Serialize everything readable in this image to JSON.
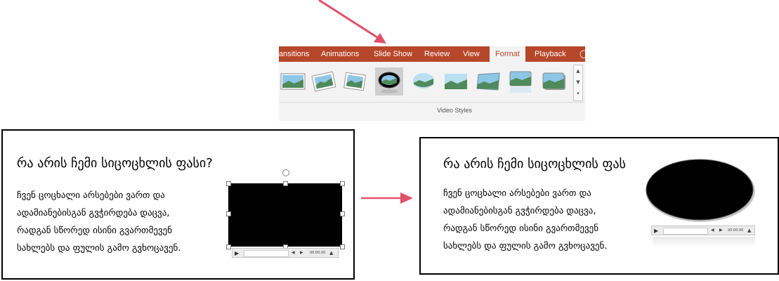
{
  "ribbon": {
    "tabs": [
      {
        "label": "ansitions"
      },
      {
        "label": "Animations"
      },
      {
        "label": "Slide Show"
      },
      {
        "label": "Review"
      },
      {
        "label": "View"
      },
      {
        "label": "Format",
        "active": true
      },
      {
        "label": "Playback"
      }
    ],
    "group_label": "Video Styles",
    "video_styles": [
      "simple-frame-style",
      "rotated-white-frame-style",
      "tilted-white-frame-style",
      "oval-black-style",
      "soft-edge-oval-style",
      "soft-edge-rectangle-style",
      "beveled-perspective-style",
      "reflected-rounded-style",
      "rounded-shadow-style"
    ],
    "selected_style_index": 3
  },
  "colors": {
    "tab_bar": "#b7472a",
    "arrow": "#e0506a",
    "ribbon_bg": "#f3f3f3"
  },
  "slide_before": {
    "title": "რა არის ჩემი სიცოცხლის ფასი?",
    "body": [
      "ჩვენ ცოცხალი არსებები ვართ და",
      "ადამიანებისგან გვჭირდება დაცვა,",
      "რადგან სწორედ ისინი გვართმევენ",
      "სახლებს და ფულის გამო გვხოცავენ."
    ],
    "video_time": "00:00.00"
  },
  "slide_after": {
    "title": "რა არის ჩემი სიცოცხლის ფას",
    "body": [
      "ჩვენ ცოცხალი არსებები ვართ და",
      "ადამიანებისგან გვჭირდება დაცვა,",
      "რადგან სწორედ ისინი გვართმევენ",
      "სახლებს და ფულის გამო გვხოცავენ."
    ],
    "video_time": "00:00.00"
  },
  "icons": {
    "top_arrow": "diagonal-arrow-icon",
    "transition_arrow": "right-arrow-icon"
  }
}
